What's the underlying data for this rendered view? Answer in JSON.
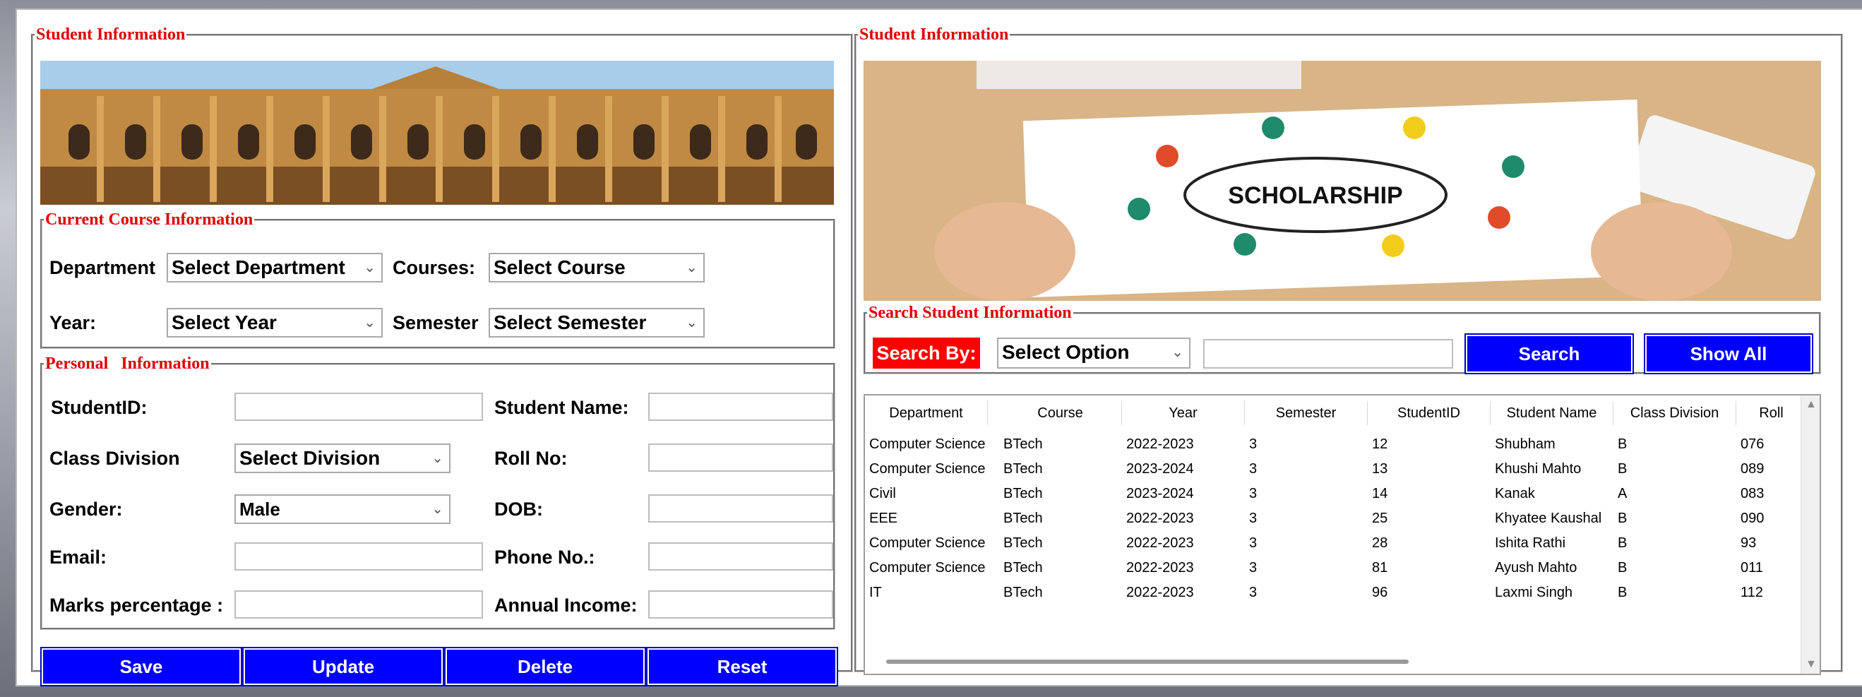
{
  "left_panel": {
    "legend": "Student Information",
    "course_section": {
      "legend": "Current Course Information",
      "department_label": "Department",
      "department_value": "Select Department",
      "courses_label": "Courses:",
      "courses_value": "Select Course",
      "year_label": "Year:",
      "year_value": "Select Year",
      "semester_label": "Semester",
      "semester_value": "Select Semester"
    },
    "personal_section": {
      "legend": "Personal   Information",
      "student_id_label": "StudentID:",
      "student_name_label": "Student Name:",
      "class_division_label": "Class Division",
      "class_division_value": "Select Division",
      "roll_no_label": "Roll No:",
      "gender_label": "Gender:",
      "gender_value": "Male",
      "dob_label": "DOB:",
      "email_label": "Email:",
      "phone_label": "Phone No.:",
      "marks_label": "Marks percentage :",
      "income_label": "Annual Income:"
    },
    "buttons": {
      "save": "Save",
      "update": "Update",
      "delete": "Delete",
      "reset": "Reset"
    }
  },
  "right_panel": {
    "legend": "Student Information",
    "image_text": "SCHOLARSHIP",
    "search_section": {
      "legend": "Search Student Information",
      "search_by_label": "Search By:",
      "search_option_value": "Select Option",
      "search_button": "Search",
      "show_all_button": "Show All"
    },
    "table": {
      "columns": [
        "Department",
        "Course",
        "Year",
        "Semester",
        "StudentID",
        "Student Name",
        "Class Division",
        "Roll"
      ],
      "rows": [
        [
          "Computer Science",
          "BTech",
          "2022-2023",
          "3",
          "12",
          "Shubham",
          "B",
          "076"
        ],
        [
          "Computer Science",
          "BTech",
          "2023-2024",
          "3",
          "13",
          "Khushi Mahto",
          "B",
          "089"
        ],
        [
          "Civil",
          "BTech",
          "2023-2024",
          "3",
          "14",
          "Kanak",
          "A",
          "083"
        ],
        [
          "EEE",
          "BTech",
          "2022-2023",
          "3",
          "25",
          "Khyatee Kaushal",
          "B",
          "090"
        ],
        [
          "Computer Science",
          "BTech",
          "2022-2023",
          "3",
          "28",
          "Ishita Rathi",
          "B",
          "93"
        ],
        [
          "Computer Science",
          "BTech",
          "2022-2023",
          "3",
          "81",
          "Ayush Mahto",
          "B",
          "011"
        ],
        [
          "IT",
          "BTech",
          "2022-2023",
          "3",
          "96",
          "Laxmi Singh",
          "B",
          "112"
        ]
      ]
    }
  },
  "colors": {
    "legend_red": "#e00000",
    "button_blue": "#0000ff",
    "search_by_red": "#ff0000"
  }
}
